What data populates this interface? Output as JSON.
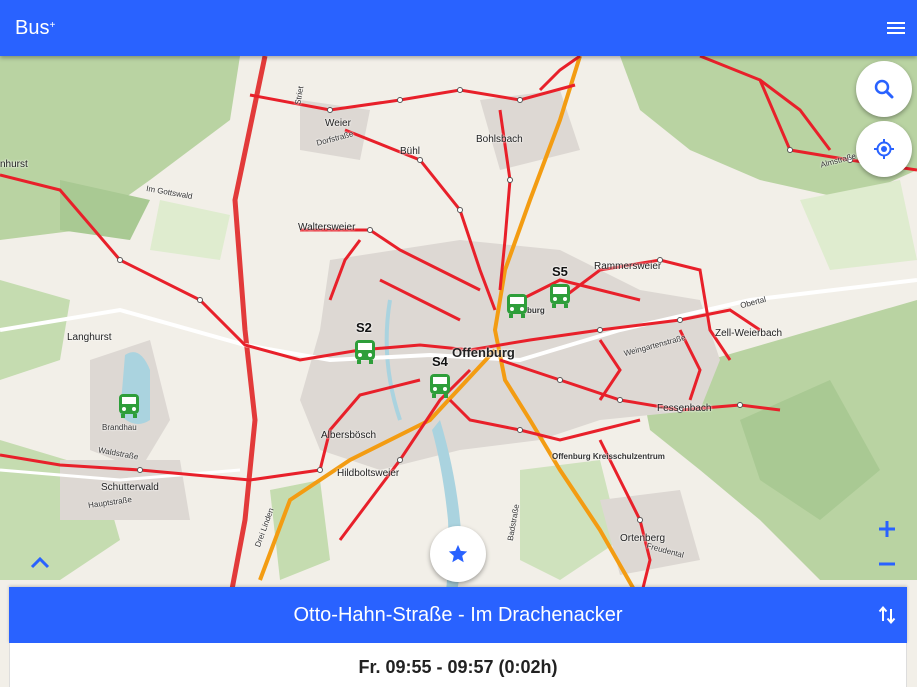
{
  "app": {
    "title": "Bus",
    "title_sup": "+",
    "menu_icon": "menu-icon"
  },
  "colors": {
    "appbar": "#2962ff",
    "route": "#e8202a",
    "railway": "#f39c12",
    "bus_stop": "#2e9e3a",
    "forest": "#b9d3a2"
  },
  "map": {
    "labels": [
      {
        "key": "weier",
        "text": "Weier"
      },
      {
        "key": "dorfstrasse",
        "text": "Dorfstraße"
      },
      {
        "key": "buhl",
        "text": "Bühl"
      },
      {
        "key": "bohlsbach",
        "text": "Bohlsbach"
      },
      {
        "key": "im_gottswald",
        "text": "Im Gottswald"
      },
      {
        "key": "waltersweier",
        "text": "Waltersweier"
      },
      {
        "key": "rammersweier",
        "text": "Rammersweier"
      },
      {
        "key": "langhurst",
        "text": "Langhurst"
      },
      {
        "key": "offenburg",
        "text": "Offenburg"
      },
      {
        "key": "zell_weierbach",
        "text": "Zell-Weierbach"
      },
      {
        "key": "obertal",
        "text": "Obertal"
      },
      {
        "key": "brandhau",
        "text": "Brandhau"
      },
      {
        "key": "waldstrasse",
        "text": "Waldstraße"
      },
      {
        "key": "albersbosch",
        "text": "Albersbösch"
      },
      {
        "key": "hildboltsweier",
        "text": "Hildboltsweier"
      },
      {
        "key": "schutterwald",
        "text": "Schutterwald"
      },
      {
        "key": "hauptstrasse",
        "text": "Hauptstraße"
      },
      {
        "key": "fessenbach",
        "text": "Fessenbach"
      },
      {
        "key": "kreisschulzentrum",
        "text": "Offenburg Kreisschulzentrum"
      },
      {
        "key": "ortenberg",
        "text": "Ortenberg"
      },
      {
        "key": "almstrasse",
        "text": "Almstraße"
      },
      {
        "key": "hurst",
        "text": "nhurst"
      },
      {
        "key": "striet",
        "text": "Striet"
      },
      {
        "key": "burg",
        "text": "burg"
      },
      {
        "key": "weingartenstrasse",
        "text": "Weingartenstraße"
      },
      {
        "key": "drei_linden",
        "text": "Drei Linden"
      },
      {
        "key": "badstrasse",
        "text": "Badstraße"
      },
      {
        "key": "freudental",
        "text": "Freudental"
      }
    ],
    "stops": [
      {
        "key": "s2",
        "label": "S2"
      },
      {
        "key": "s4",
        "label": "S4"
      },
      {
        "key": "s5",
        "label": "S5"
      },
      {
        "key": "bohlsbach_stop",
        "label": ""
      },
      {
        "key": "langhurst_stop",
        "label": ""
      }
    ]
  },
  "controls": {
    "search_icon": "search-icon",
    "locate_icon": "my-location-icon",
    "zoom_in_icon": "plus-icon",
    "zoom_out_icon": "minus-icon",
    "favorite_icon": "star-icon",
    "collapse_icon": "chevron-up-icon"
  },
  "route": {
    "title": "Otto-Hahn-Straße - Im Drachenacker",
    "swap_icon": "swap-vertical-icon",
    "trip_time": "Fr. 09:55 - 09:57 (0:02h)"
  }
}
